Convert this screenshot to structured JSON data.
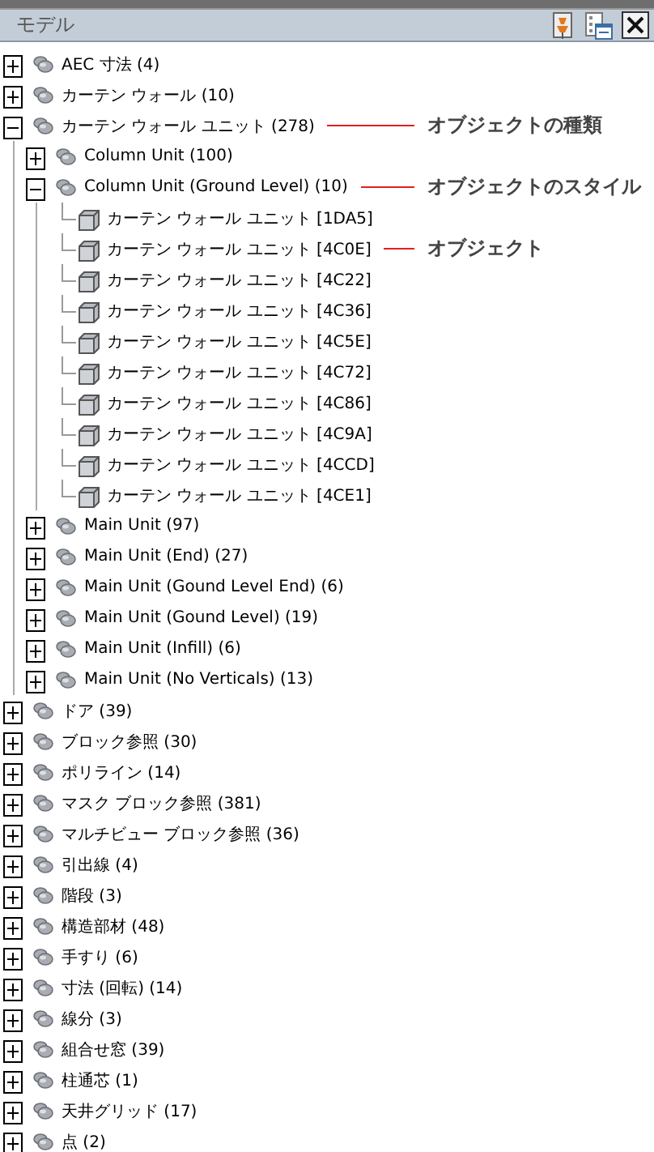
{
  "panel": {
    "title": "モデル"
  },
  "tree": [
    {
      "label": "AEC 寸法 (4)",
      "expanded": false
    },
    {
      "label": "カーテン ウォール (10)",
      "expanded": false
    },
    {
      "label": "カーテン ウォール ユニット (278)",
      "expanded": true,
      "annotation": "オブジェクトの種類",
      "children": [
        {
          "label": "Column Unit (100)",
          "expanded": false
        },
        {
          "label": "Column Unit (Ground Level) (10)",
          "expanded": true,
          "annotation": "オブジェクトのスタイル",
          "children": [
            {
              "label": "カーテン ウォール ユニット [1DA5]"
            },
            {
              "label": "カーテン ウォール ユニット [4C0E]",
              "annotation": "オブジェクト"
            },
            {
              "label": "カーテン ウォール ユニット [4C22]"
            },
            {
              "label": "カーテン ウォール ユニット [4C36]"
            },
            {
              "label": "カーテン ウォール ユニット [4C5E]"
            },
            {
              "label": "カーテン ウォール ユニット [4C72]"
            },
            {
              "label": "カーテン ウォール ユニット [4C86]"
            },
            {
              "label": "カーテン ウォール ユニット [4C9A]"
            },
            {
              "label": "カーテン ウォール ユニット [4CCD]"
            },
            {
              "label": "カーテン ウォール ユニット [4CE1]"
            }
          ]
        },
        {
          "label": "Main Unit (97)",
          "expanded": false
        },
        {
          "label": "Main Unit (End) (27)",
          "expanded": false
        },
        {
          "label": "Main Unit (Gound Level End) (6)",
          "expanded": false
        },
        {
          "label": "Main Unit (Gound Level) (19)",
          "expanded": false
        },
        {
          "label": "Main Unit (Infill) (6)",
          "expanded": false
        },
        {
          "label": "Main Unit (No Verticals) (13)",
          "expanded": false
        }
      ]
    },
    {
      "label": "ドア (39)",
      "expanded": false
    },
    {
      "label": "ブロック参照 (30)",
      "expanded": false
    },
    {
      "label": "ポリライン (14)",
      "expanded": false
    },
    {
      "label": "マスク ブロック参照 (381)",
      "expanded": false
    },
    {
      "label": "マルチビュー ブロック参照 (36)",
      "expanded": false
    },
    {
      "label": "引出線 (4)",
      "expanded": false
    },
    {
      "label": "階段 (3)",
      "expanded": false
    },
    {
      "label": "構造部材 (48)",
      "expanded": false
    },
    {
      "label": "手すり (6)",
      "expanded": false
    },
    {
      "label": "寸法 (回転) (14)",
      "expanded": false
    },
    {
      "label": "線分 (3)",
      "expanded": false
    },
    {
      "label": "組合せ窓 (39)",
      "expanded": false
    },
    {
      "label": "柱通芯 (1)",
      "expanded": false
    },
    {
      "label": "天井グリッド (17)",
      "expanded": false
    },
    {
      "label": "点 (2)",
      "expanded": false
    }
  ]
}
